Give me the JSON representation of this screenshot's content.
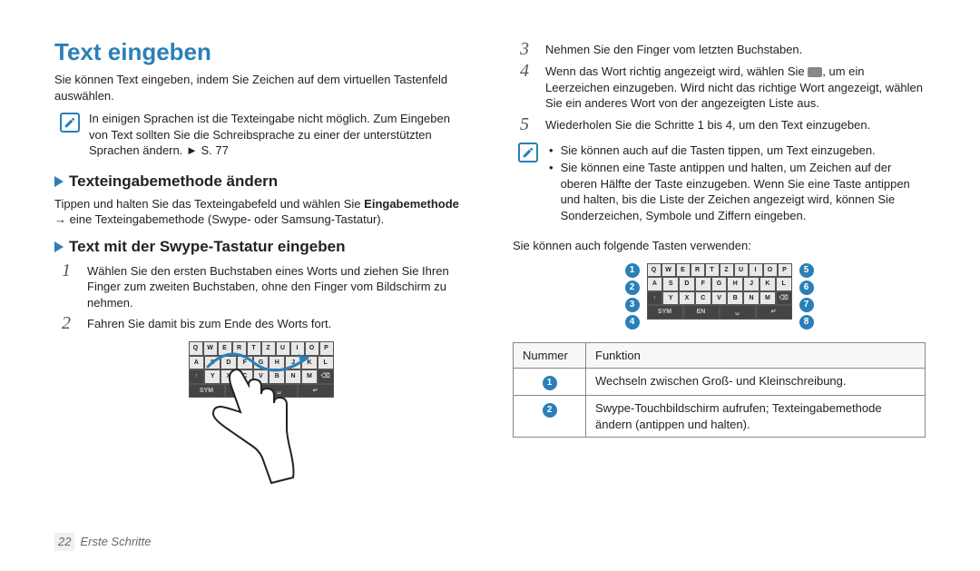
{
  "title": "Text eingeben",
  "intro": "Sie können Text eingeben, indem Sie Zeichen auf dem virtuellen Tastenfeld auswählen.",
  "note1": "In einigen Sprachen ist die Texteingabe nicht möglich. Zum Eingeben von Text sollten Sie die Schreibsprache zu einer der unterstützten Sprachen ändern. ► S. 77",
  "section1": {
    "title": "Texteingabemethode ändern",
    "body_a": "Tippen und halten Sie das Texteingabefeld und wählen Sie ",
    "body_b": "Eingabemethode",
    "body_c": " → eine Texteingabemethode (Swype- oder Samsung-Tastatur)."
  },
  "section2": {
    "title": "Text mit der Swype-Tastatur eingeben",
    "steps": [
      "Wählen Sie den ersten Buchstaben eines Worts und ziehen Sie Ihren Finger zum zweiten Buchstaben, ohne den Finger vom Bildschirm zu nehmen.",
      "Fahren Sie damit bis zum Ende des Worts fort."
    ]
  },
  "right_steps": {
    "s3": "Nehmen Sie den Finger vom letzten Buchstaben.",
    "s4_a": "Wenn das Wort richtig angezeigt wird, wählen Sie ",
    "s4_b": ", um ein Leerzeichen einzugeben. Wird nicht das richtige Wort angezeigt, wählen Sie ein anderes Wort von der angezeigten Liste aus.",
    "s5": "Wiederholen Sie die Schritte 1 bis 4, um den Text einzugeben."
  },
  "note2_bullets": [
    "Sie können auch auf die Tasten tippen, um Text einzugeben.",
    "Sie können eine Taste antippen und halten, um Zeichen auf der oberen Hälfte der Taste einzugeben. Wenn Sie eine Taste antippen und halten, bis die Liste der Zeichen angezeigt wird, können Sie Sonderzeichen, Symbole und Ziffern eingeben."
  ],
  "also_use": "Sie können auch folgende Tasten verwenden:",
  "kbd_rows": [
    [
      "Q",
      "W",
      "E",
      "R",
      "T",
      "Z",
      "U",
      "I",
      "O",
      "P"
    ],
    [
      "A",
      "S",
      "D",
      "F",
      "G",
      "H",
      "J",
      "K",
      "L"
    ],
    [
      "↑",
      "Y",
      "X",
      "C",
      "V",
      "B",
      "N",
      "M",
      "⌫"
    ]
  ],
  "kbd_bottom": [
    "SYM",
    "EN",
    "␣",
    "↵"
  ],
  "callouts_left": [
    "1",
    "2",
    "3",
    "4"
  ],
  "callouts_right": [
    "5",
    "6",
    "7",
    "8"
  ],
  "table": {
    "headers": [
      "Nummer",
      "Funktion"
    ],
    "rows": [
      {
        "num": "1",
        "text": "Wechseln zwischen Groß- und Kleinschreibung."
      },
      {
        "num": "2",
        "text": "Swype-Touchbildschirm aufrufen; Texteingabemethode ändern (antippen und halten)."
      }
    ]
  },
  "footer": {
    "page": "22",
    "section": "Erste Schritte"
  }
}
